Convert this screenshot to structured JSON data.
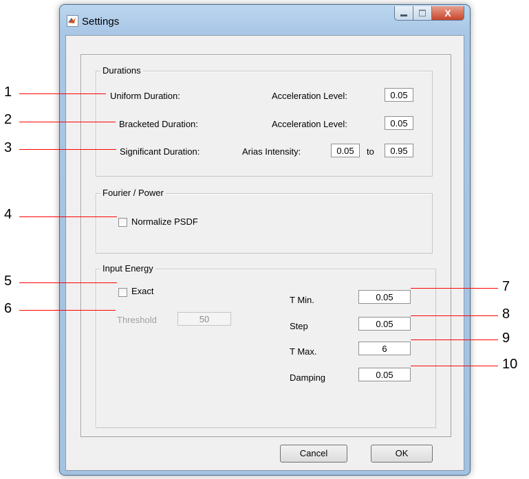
{
  "window": {
    "title": "Settings",
    "close_glyph": "X"
  },
  "durations": {
    "legend": "Durations",
    "uniform_label": "Uniform Duration:",
    "uniform_accel_label": "Acceleration Level:",
    "uniform_accel_value": "0.05",
    "bracketed_label": "Bracketed Duration:",
    "bracketed_accel_label": "Acceleration Level:",
    "bracketed_accel_value": "0.05",
    "significant_label": "Significant Duration:",
    "arias_label": "Arias Intensity:",
    "arias_from": "0.05",
    "to_label": "to",
    "arias_to": "0.95"
  },
  "fourier": {
    "legend": "Fourier / Power",
    "normalize_label": "Normalize PSDF"
  },
  "energy": {
    "legend": "Input Energy",
    "exact_label": "Exact",
    "threshold_label": "Threshold",
    "threshold_value": "50",
    "tmin_label": "T Min.",
    "tmin_value": "0.05",
    "step_label": "Step",
    "step_value": "0.05",
    "tmax_label": "T Max.",
    "tmax_value": "6",
    "damping_label": "Damping",
    "damping_value": "0.05"
  },
  "buttons": {
    "cancel": "Cancel",
    "ok": "OK"
  },
  "callouts": [
    "1",
    "2",
    "3",
    "4",
    "5",
    "6",
    "7",
    "8",
    "9",
    "10"
  ],
  "colors": {
    "callout_line": "#ff0000",
    "title_bar": "#a9c7e6",
    "close_button": "#c8442a"
  }
}
